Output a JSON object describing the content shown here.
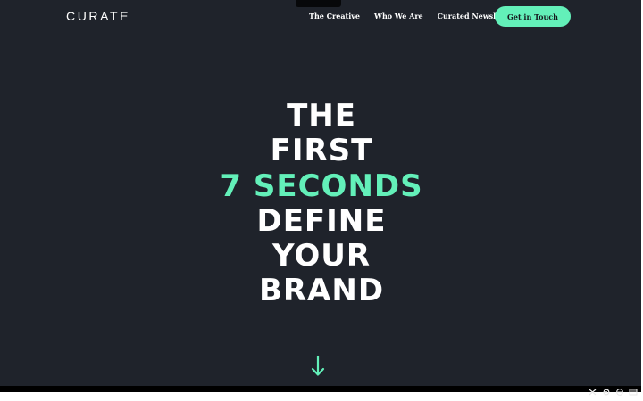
{
  "header": {
    "logo": "CURATE",
    "nav": [
      {
        "label": "The Creative"
      },
      {
        "label": "Who We Are"
      },
      {
        "label": "Curated Newsletter"
      }
    ],
    "cta_label": "Get in Touch"
  },
  "hero": {
    "lines": [
      "THE",
      "FIRST",
      "7 SECONDS",
      "DEFINE",
      "YOUR",
      "BRAND"
    ],
    "accent_line_index": 2
  },
  "icons": {
    "scroll_down": "arrow-down-icon",
    "tray": [
      "cut-icon",
      "gear-icon",
      "globe-icon",
      "window-icon"
    ]
  },
  "colors": {
    "background": "#1f232b",
    "accent": "#63f0b9",
    "text": "#ffffff"
  }
}
